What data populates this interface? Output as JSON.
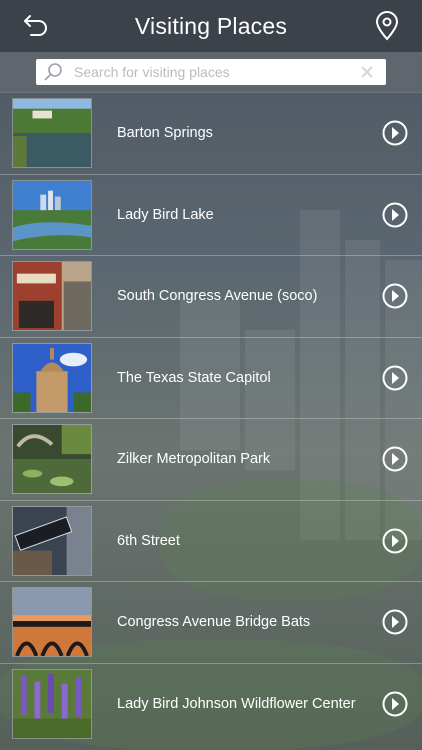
{
  "header": {
    "title": "Visiting Places",
    "back_icon": "back-arrow-icon",
    "map_icon": "location-pin-icon"
  },
  "search": {
    "placeholder": "Search for visiting places",
    "value": ""
  },
  "places": [
    {
      "name": "Barton Springs",
      "thumb": "barton-springs-photo"
    },
    {
      "name": "Lady Bird Lake",
      "thumb": "lady-bird-lake-photo"
    },
    {
      "name": "South Congress Avenue (soco)",
      "thumb": "south-congress-photo"
    },
    {
      "name": "The Texas State Capitol",
      "thumb": "texas-capitol-photo"
    },
    {
      "name": "Zilker Metropolitan Park",
      "thumb": "zilker-park-photo"
    },
    {
      "name": "6th Street",
      "thumb": "sixth-street-photo"
    },
    {
      "name": "Congress Avenue Bridge Bats",
      "thumb": "bridge-bats-photo"
    },
    {
      "name": "Lady Bird Johnson Wildflower Center",
      "thumb": "wildflower-center-photo"
    }
  ],
  "colors": {
    "header_bg": "#3c4249",
    "search_bar_bg": "#5f666d",
    "text": "#ffffff"
  }
}
